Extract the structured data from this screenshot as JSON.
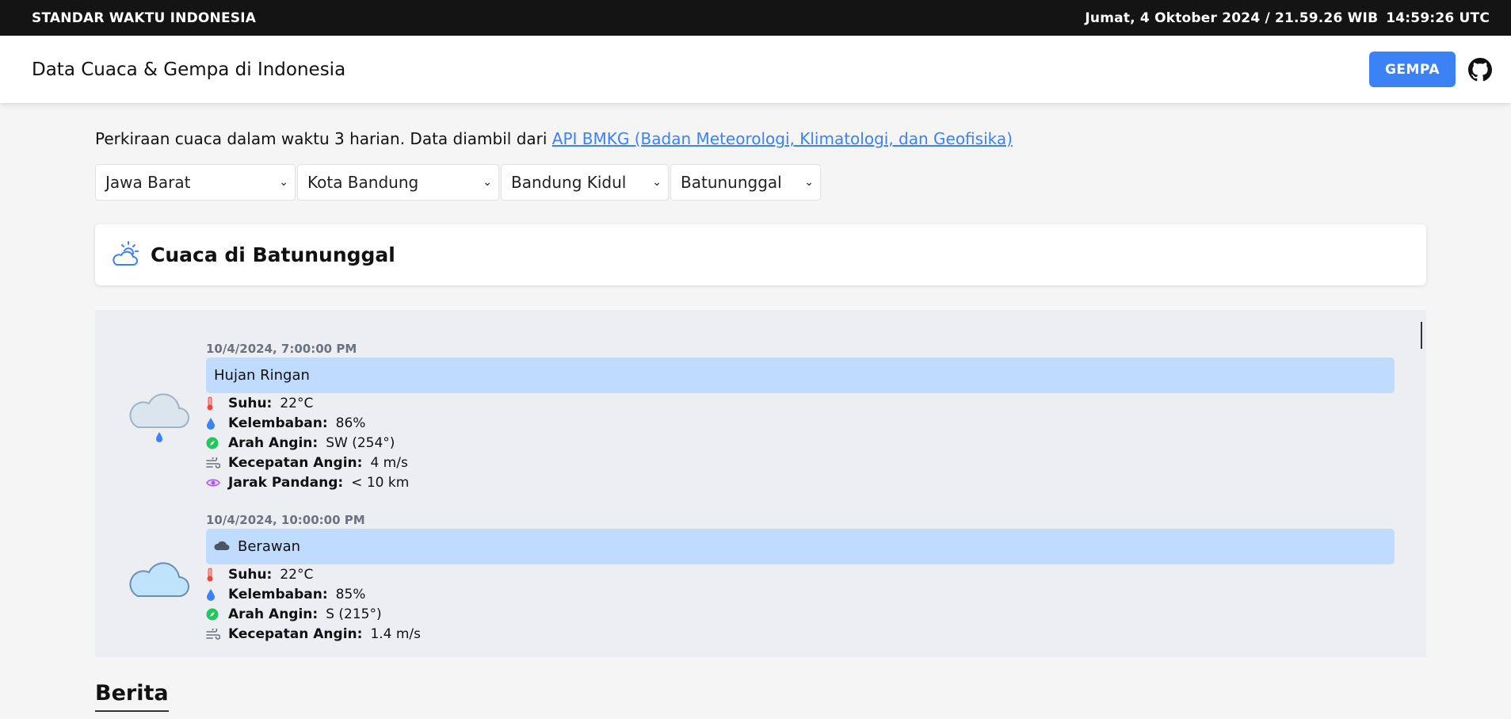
{
  "topbar": {
    "title": "STANDAR WAKTU INDONESIA",
    "local_time": "Jumat, 4 Oktober 2024 / 21.59.26 WIB",
    "utc_time": "14:59:26 UTC"
  },
  "navbar": {
    "brand": "Data Cuaca & Gempa di Indonesia",
    "gempa_label": "GEMPA",
    "github_icon": "github-icon"
  },
  "intro": {
    "text": "Perkiraan cuaca dalam waktu 3 harian. Data diambil dari ",
    "link": "API BMKG (Badan Meteorologi, Klimatologi, dan Geofisika)"
  },
  "selects": {
    "province": "Jawa Barat",
    "city": "Kota Bandung",
    "district": "Bandung Kidul",
    "village": "Batununggal"
  },
  "weather_card": {
    "title": "Cuaca di Batununggal",
    "icon": "sun-cloud-icon"
  },
  "forecast": [
    {
      "time": "10/4/2024, 7:00:00 PM",
      "condition": "Hujan Ringan",
      "icon": "rain-cloud-icon",
      "temp_label": "Suhu:",
      "temp": "22°C",
      "humidity_label": "Kelembaban:",
      "humidity": "86%",
      "wind_dir_label": "Arah Angin:",
      "wind_dir": "SW (254°)",
      "wind_speed_label": "Kecepatan Angin:",
      "wind_speed": "4 m/s",
      "visibility_label": "Jarak Pandang:",
      "visibility": "< 10 km"
    },
    {
      "time": "10/4/2024, 10:00:00 PM",
      "condition": "Berawan",
      "icon": "cloud-icon",
      "temp_label": "Suhu:",
      "temp": "22°C",
      "humidity_label": "Kelembaban:",
      "humidity": "85%",
      "wind_dir_label": "Arah Angin:",
      "wind_dir": "S (215°)",
      "wind_speed_label": "Kecepatan Angin:",
      "wind_speed": "1.4 m/s"
    }
  ],
  "news": {
    "heading": "Berita"
  },
  "colors": {
    "topbar_bg": "#141414",
    "accent": "#3b82f6",
    "condition_bg": "#bfdbfe",
    "thermometer": "#ef4444",
    "humidity": "#3b82f6",
    "compass": "#22c55e",
    "eye": "#a855f7"
  }
}
